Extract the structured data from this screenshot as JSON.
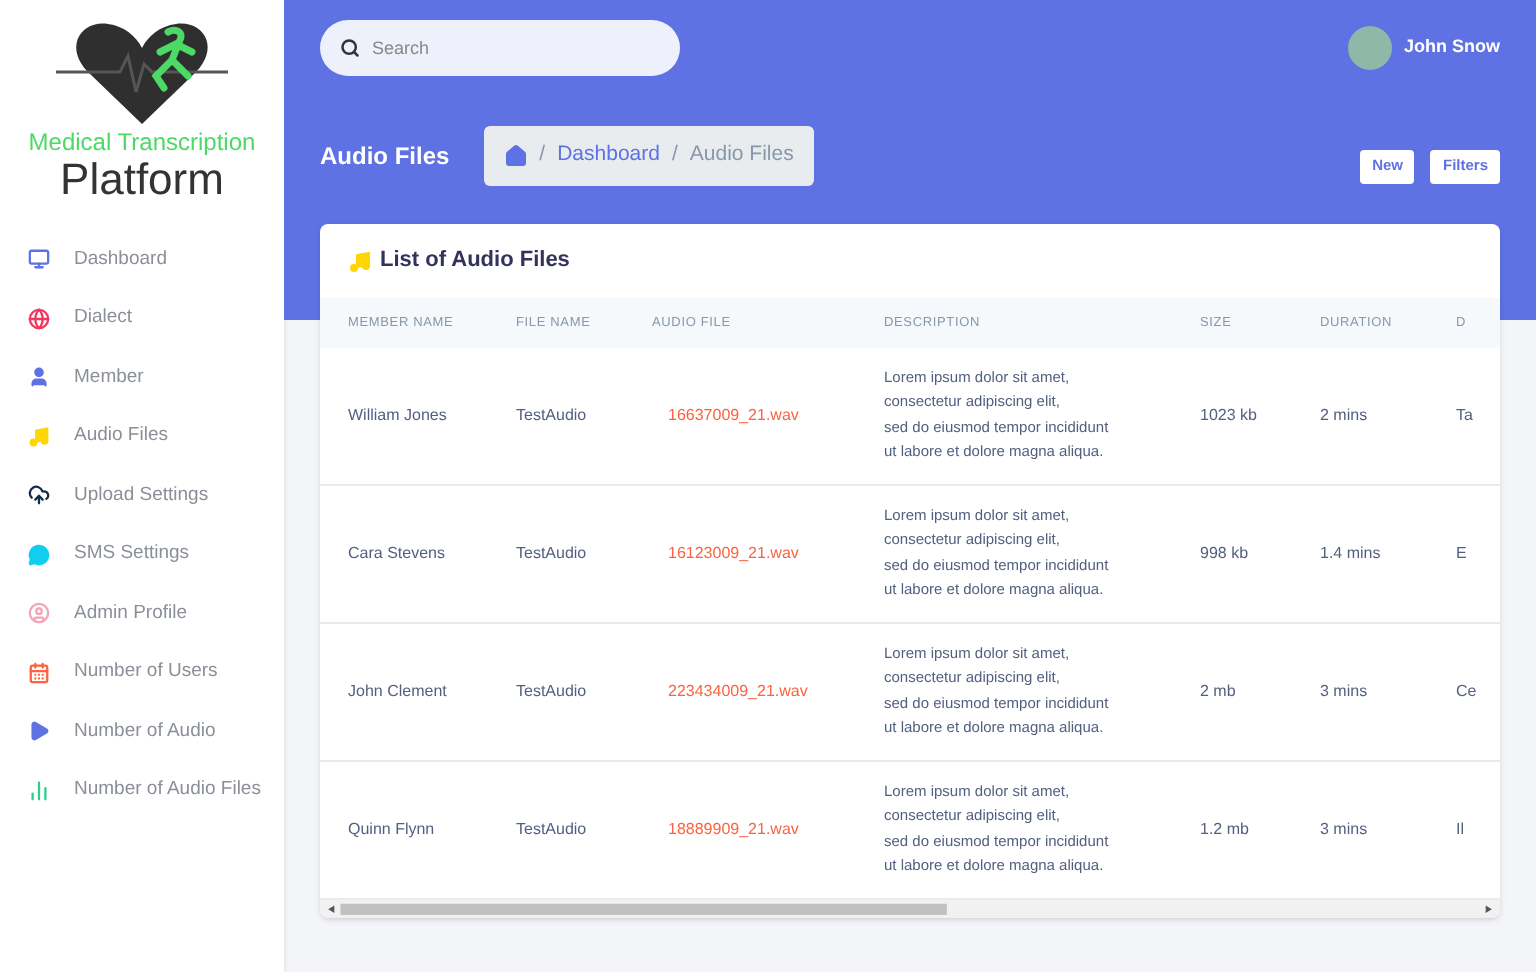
{
  "logo": {
    "tagline": "Medical Transcription",
    "name": "Platform"
  },
  "sidebar": {
    "items": [
      {
        "label": "Dashboard",
        "selected": false
      },
      {
        "label": "Dialect",
        "selected": false
      },
      {
        "label": "Member",
        "selected": false
      },
      {
        "label": "Audio Files",
        "selected": false
      },
      {
        "label": "Upload Settings",
        "selected": false
      },
      {
        "label": "SMS Settings",
        "selected": false
      },
      {
        "label": "Admin Profile",
        "selected": false
      },
      {
        "label": "Number of Users",
        "selected": false
      },
      {
        "label": "Number of Audio",
        "selected": false
      },
      {
        "label": "Number of Audio Files",
        "selected": false
      }
    ]
  },
  "search": {
    "placeholder": "Search"
  },
  "user": {
    "name": "John Snow"
  },
  "page_title": "Audio Files",
  "breadcrumb": [
    {
      "separator": "/",
      "label": "Dashboard"
    },
    {
      "separator": "/",
      "label": "Audio Files"
    }
  ],
  "actions": [
    "New",
    "Filters"
  ],
  "table": {
    "title": "List of Audio Files",
    "columns": [
      "MEMBER NAME",
      "FILE NAME",
      "AUDIO FILE",
      "DESCRIPTION",
      "SIZE",
      "DURATION",
      "D"
    ],
    "rows": [
      {
        "member": "William Jones",
        "file": "TestAudio",
        "audio": "16637009_21.wav",
        "description": "Lorem ipsum dolor sit amet,\nconsectetur adipiscing elit,\nsed do eiusmod tempor incididunt\nut labore et dolore magna aliqua.",
        "size": "1023 kb",
        "duration": "2 mins",
        "column_7": "Ta"
      },
      {
        "member": "Cara Stevens",
        "file": "TestAudio",
        "audio": "16123009_21.wav",
        "description": "Lorem ipsum dolor sit amet,\nconsectetur adipiscing elit,\nsed do eiusmod tempor incididunt\nut labore et dolore magna aliqua.",
        "size": "998 kb",
        "duration": "1.4 mins",
        "column_7": "E"
      },
      {
        "member": "John Clement",
        "file": "TestAudio",
        "audio": "223434009_21.wav",
        "description": "Lorem ipsum dolor sit amet,\nconsectetur adipiscing elit,\nsed do eiusmod tempor incididunt\nut labore et dolore magna aliqua.",
        "size": "2 mb",
        "duration": "3 mins",
        "column_7": "Ce"
      },
      {
        "member": "Quinn Flynn",
        "file": "TestAudio",
        "audio": "18889909_21.wav",
        "description": "Lorem ipsum dolor sit amet,\nconsectetur adipiscing elit,\nsed do eiusmod tempor incididunt\nut labore et dolore magna aliqua.",
        "size": "1.2 mb",
        "duration": "3 mins",
        "column_7": "Il"
      }
    ]
  }
}
